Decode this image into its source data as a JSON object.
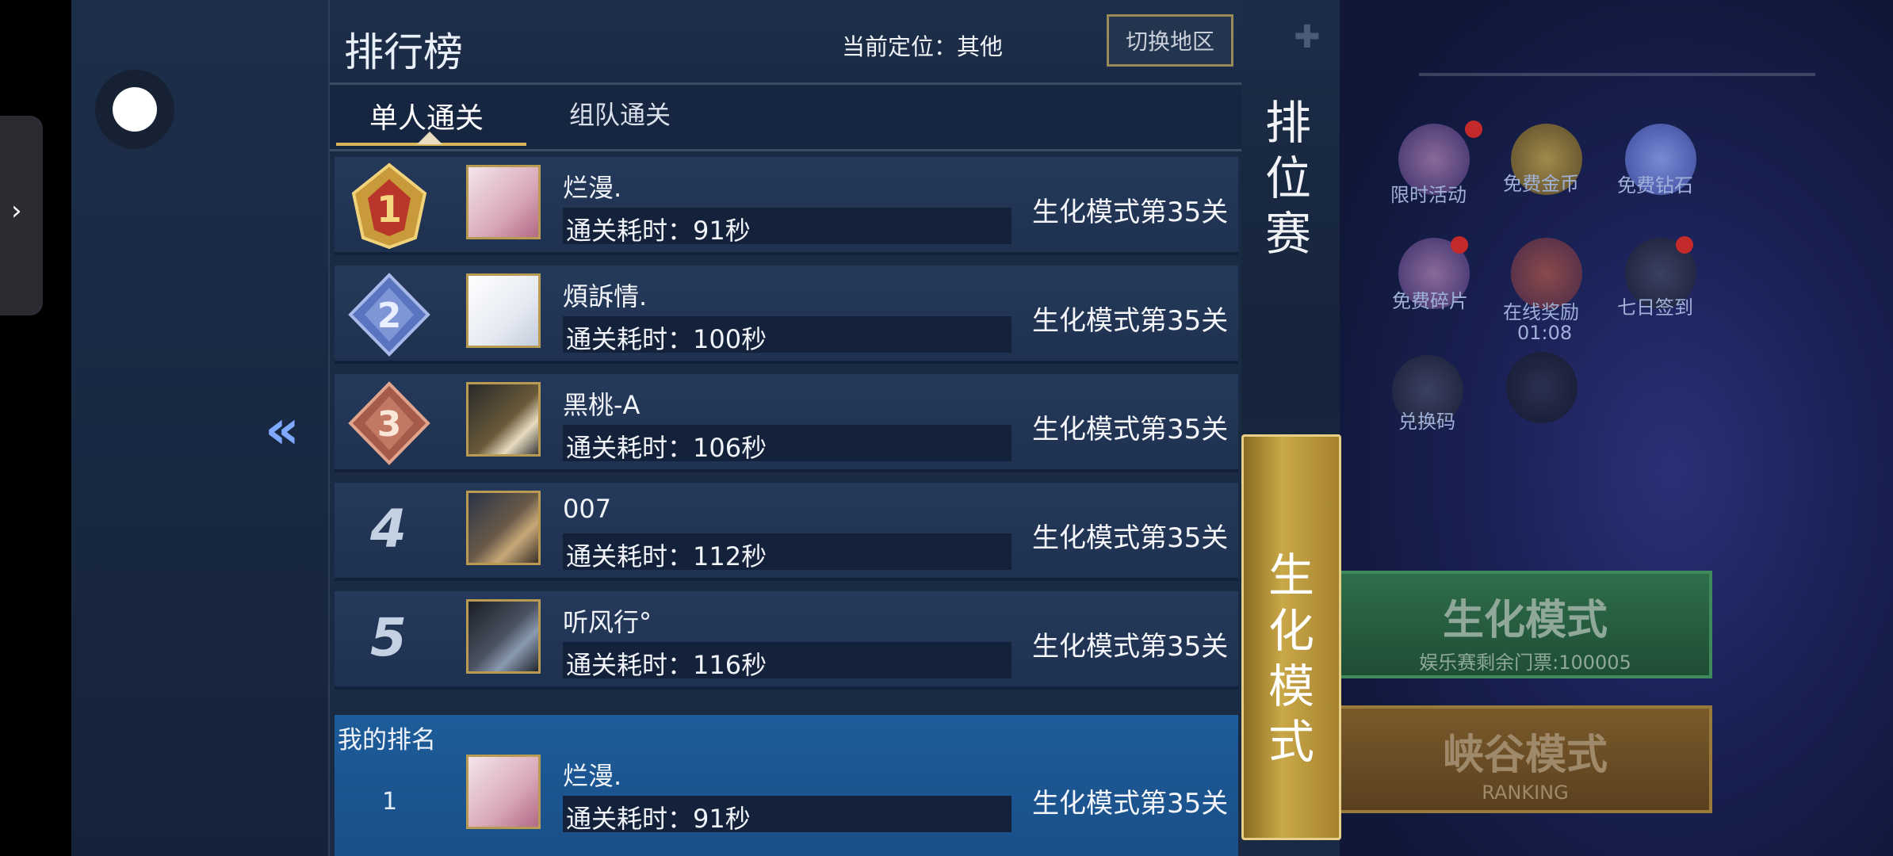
{
  "panel": {
    "title": "排行榜",
    "location_text": "当前定位：其他",
    "switch_region": "切换地区",
    "tabs": [
      "单人通关",
      "组队通关"
    ]
  },
  "ranking_rows": [
    {
      "rank": "1",
      "name": "烂漫.",
      "time": "通关耗时：91秒",
      "mode": "生化模式第35关"
    },
    {
      "rank": "2",
      "name": "煩訴情.",
      "time": "通关耗时：100秒",
      "mode": "生化模式第35关"
    },
    {
      "rank": "3",
      "name": "黑桃-A",
      "time": "通关耗时：106秒",
      "mode": "生化模式第35关"
    },
    {
      "rank": "4",
      "name": "007",
      "time": "通关耗时：112秒",
      "mode": "生化模式第35关"
    },
    {
      "rank": "5",
      "name": "听风行°",
      "time": "通关耗时：116秒",
      "mode": "生化模式第35关"
    }
  ],
  "my_rank": {
    "label": "我的排名",
    "rank": "1",
    "name": "烂漫.",
    "time": "通关耗时：91秒",
    "mode": "生化模式第35关"
  },
  "side_tabs": {
    "ranked": "排位赛",
    "biochem": "生化模式"
  },
  "background_menu": {
    "items": [
      "限时活动",
      "免费金币",
      "免费钻石",
      "免费碎片",
      "在线奖励",
      "七日签到",
      "兑换码"
    ],
    "online_timer": "01:08",
    "mode_buttons": [
      {
        "title": "生化模式",
        "sub": "娱乐赛剩余门票:100005"
      },
      {
        "title": "峡谷模式",
        "sub": "RANKING"
      }
    ]
  },
  "colors": {
    "gold": "#c9a848",
    "panel_bg": "#1a2a42",
    "my_rank_bg": "#1d5c9a"
  }
}
